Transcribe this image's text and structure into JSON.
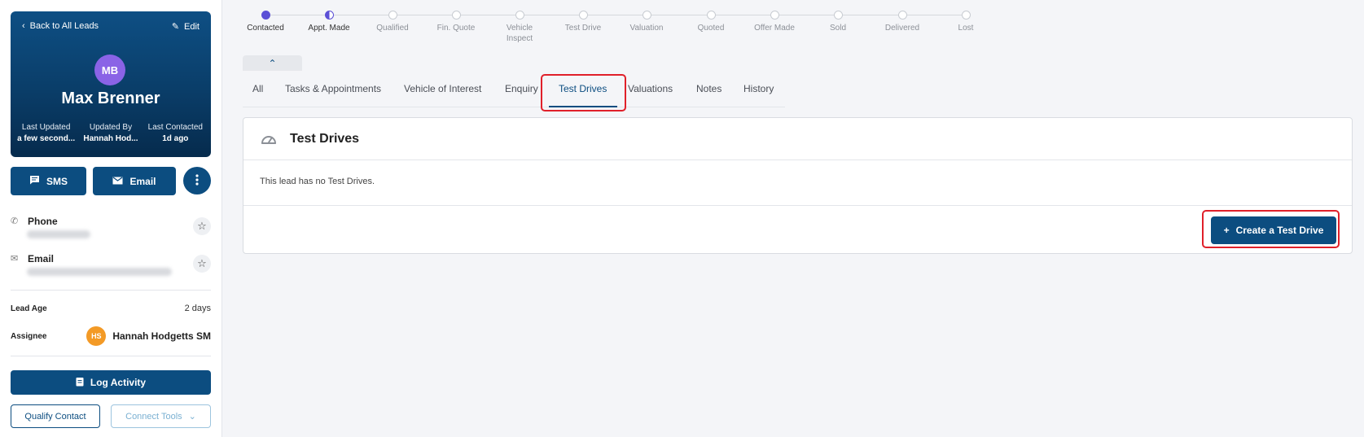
{
  "sidebar": {
    "back_label": "Back to All Leads",
    "edit_label": "Edit",
    "initials": "MB",
    "name": "Max Brenner",
    "meta": [
      {
        "label": "Last Updated",
        "value": "a few second..."
      },
      {
        "label": "Updated By",
        "value": "Hannah Hod..."
      },
      {
        "label": "Last Contacted",
        "value": "1d ago"
      }
    ],
    "sms_label": "SMS",
    "email_label": "Email",
    "phone_label": "Phone",
    "email_field_label": "Email",
    "lead_age_label": "Lead Age",
    "lead_age_value": "2 days",
    "assignee_label": "Assignee",
    "assignee_initials": "HS",
    "assignee_name": "Hannah Hodgetts SM",
    "log_activity_label": "Log Activity",
    "qualify_label": "Qualify Contact",
    "connect_label": "Connect Tools"
  },
  "stepper": {
    "steps": [
      {
        "label": "Contacted",
        "state": "done"
      },
      {
        "label": "Appt. Made",
        "state": "half"
      },
      {
        "label": "Qualified",
        "state": "todo"
      },
      {
        "label": "Fin. Quote",
        "state": "todo"
      },
      {
        "label": "Vehicle Inspect",
        "state": "todo"
      },
      {
        "label": "Test Drive",
        "state": "todo"
      },
      {
        "label": "Valuation",
        "state": "todo"
      },
      {
        "label": "Quoted",
        "state": "todo"
      },
      {
        "label": "Offer Made",
        "state": "todo"
      },
      {
        "label": "Sold",
        "state": "todo"
      },
      {
        "label": "Delivered",
        "state": "todo"
      },
      {
        "label": "Lost",
        "state": "todo"
      }
    ]
  },
  "tabs": [
    {
      "label": "All"
    },
    {
      "label": "Tasks & Appointments"
    },
    {
      "label": "Vehicle of Interest"
    },
    {
      "label": "Enquiry"
    },
    {
      "label": "Test Drives",
      "active": true
    },
    {
      "label": "Valuations"
    },
    {
      "label": "Notes"
    },
    {
      "label": "History"
    }
  ],
  "panel": {
    "title": "Test Drives",
    "empty_message": "This lead has no Test Drives.",
    "create_label": "Create a Test Drive"
  },
  "colors": {
    "brand": "#0c4d80",
    "step_done": "#5b4fd6",
    "highlight": "#e0202a",
    "assignee_avatar": "#f39a26",
    "lead_avatar": "#8a63e6"
  }
}
